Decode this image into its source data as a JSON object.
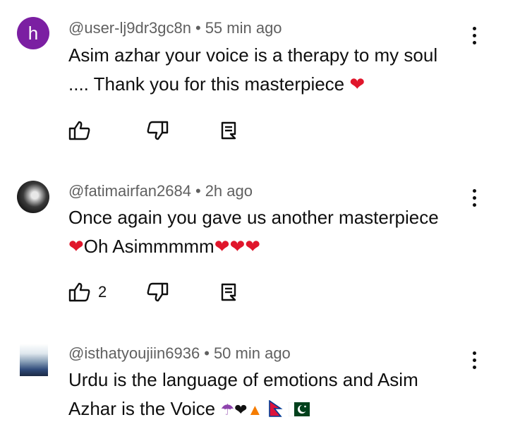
{
  "comments": [
    {
      "avatar_letter": "h",
      "avatar_color": "#7b1fa2",
      "handle": "@user-lj9dr3gc8n",
      "time": "55 min ago",
      "line1": "Asim azhar your voice is a therapy to my soul",
      "line2": ".... Thank you for this masterpiece",
      "like_count": ""
    },
    {
      "handle": "@fatimairfan2684",
      "time": "2h ago",
      "line1": "Once again you gave us another masterpiece",
      "line2": "Oh Asimmmmm",
      "like_count": "2"
    },
    {
      "handle": "@isthatyoujiin6936",
      "time": "50 min ago",
      "line1": "Urdu is the language of emotions and Asim",
      "line2": "Azhar is the Voice"
    }
  ],
  "separator": "•",
  "icons": {
    "like": "thumbs-up-icon",
    "dislike": "thumbs-down-icon",
    "reply": "reply-comment-icon",
    "more": "more-vertical-icon"
  },
  "colors": {
    "heart": "#e0162b",
    "meta": "#606060",
    "text": "#0f0f0f"
  }
}
